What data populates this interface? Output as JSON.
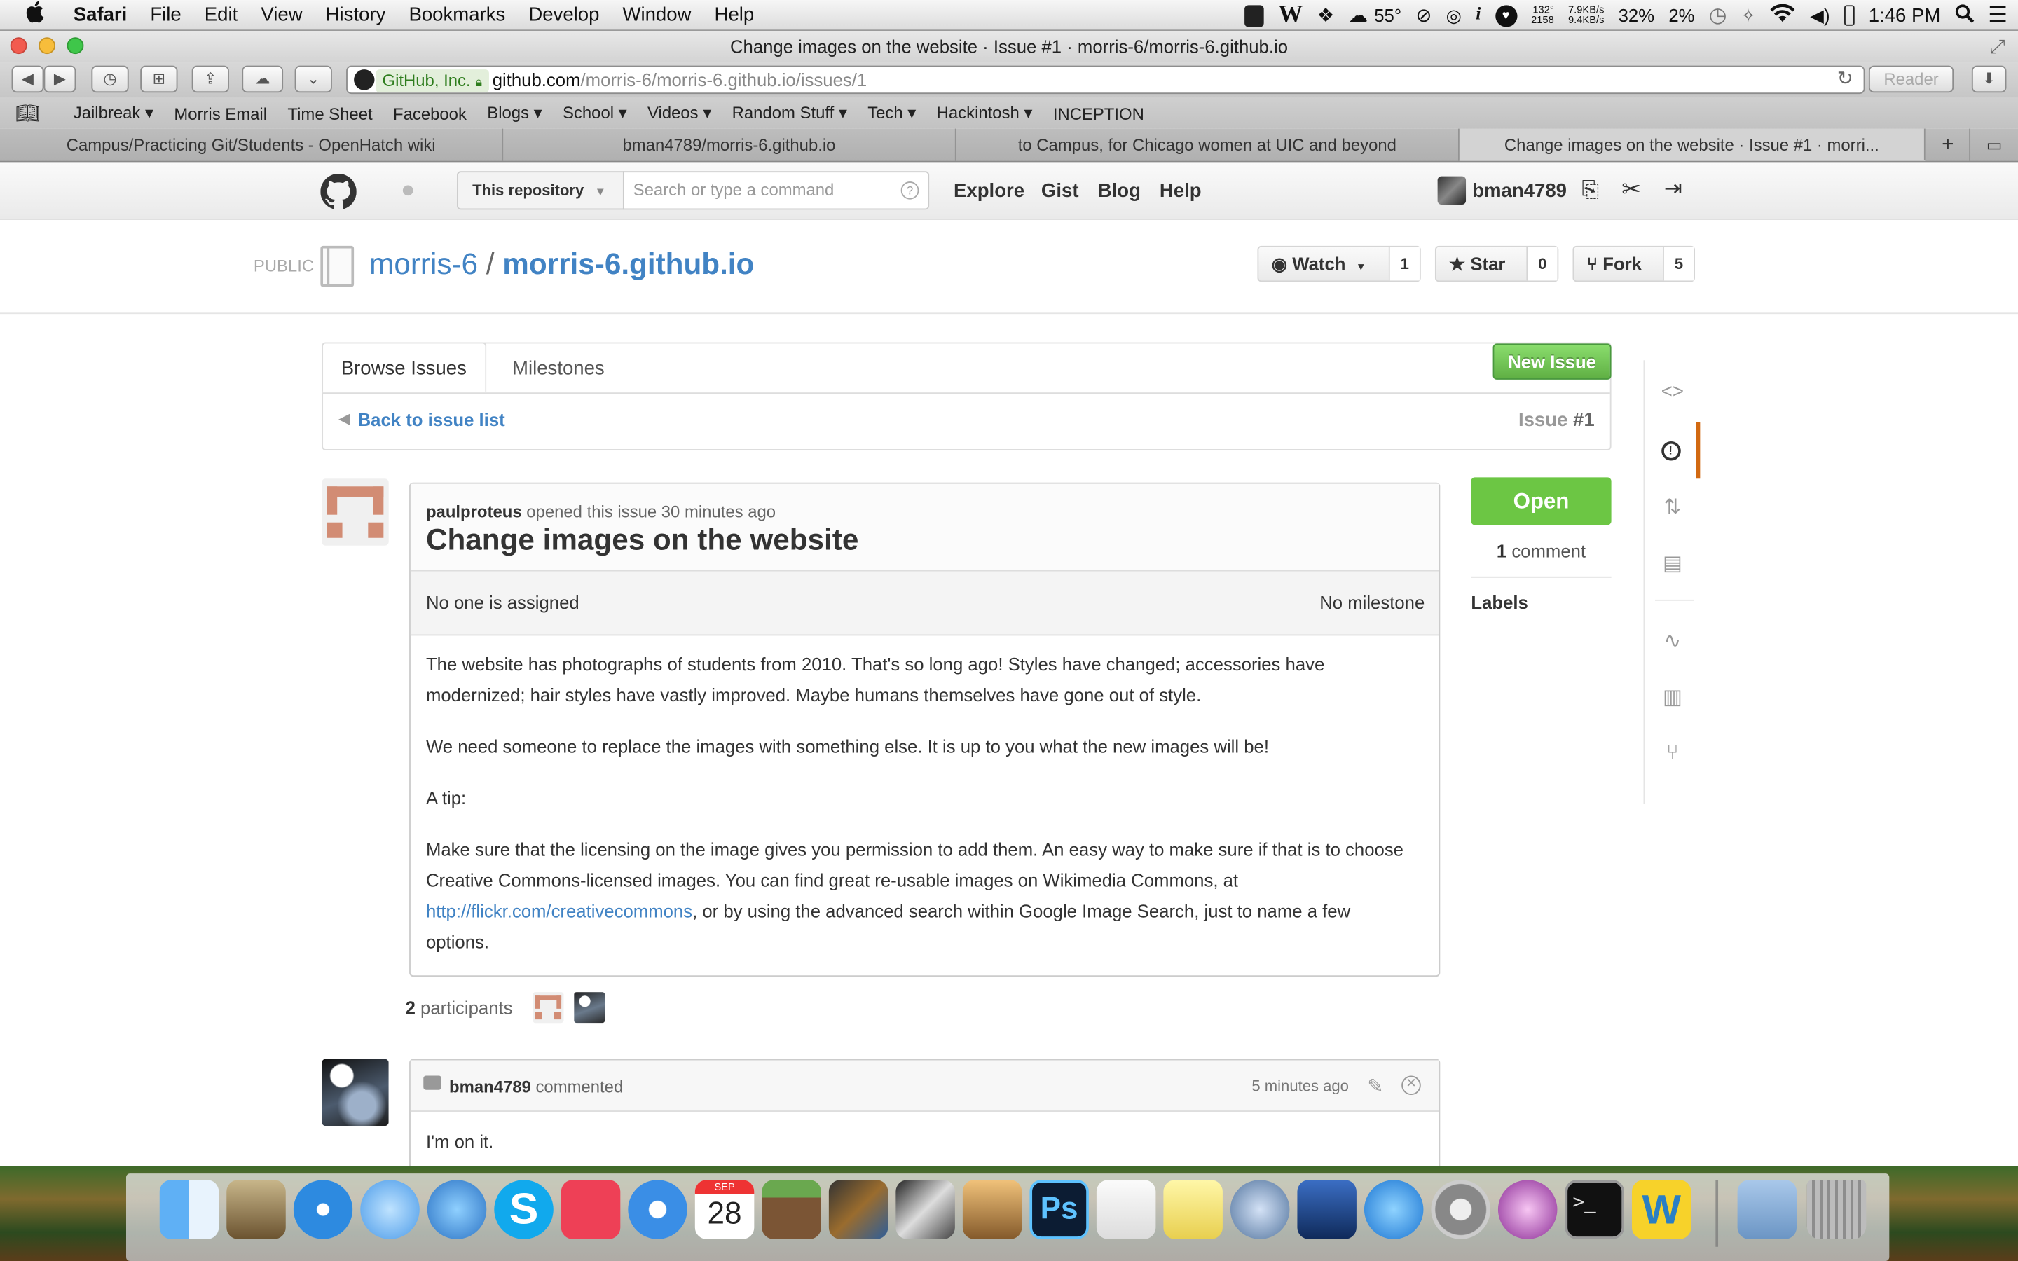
{
  "menubar": {
    "apple": "",
    "app": "Safari",
    "items": [
      "File",
      "Edit",
      "View",
      "History",
      "Bookmarks",
      "Develop",
      "Window",
      "Help"
    ],
    "temperature": "55°",
    "temp_sensor_top": "132°",
    "temp_sensor_bottom": "2158",
    "net_up": "7.9KB/s",
    "net_down": "9.4KB/s",
    "cpu": "32%",
    "mem": "2%",
    "time": "1:46 PM"
  },
  "window": {
    "title": "Change images on the website · Issue #1 · morris-6/morris-6.github.io"
  },
  "toolbar": {
    "ev_cert": "GitHub, Inc.",
    "url_host": "github.com",
    "url_path": "/morris-6/morris-6.github.io/issues/1",
    "reader": "Reader"
  },
  "bookmarks": [
    {
      "label": "Jailbreak ▾"
    },
    {
      "label": "Morris Email"
    },
    {
      "label": "Time Sheet"
    },
    {
      "label": "Facebook"
    },
    {
      "label": "Blogs ▾"
    },
    {
      "label": "School ▾"
    },
    {
      "label": "Videos ▾"
    },
    {
      "label": "Random Stuff ▾"
    },
    {
      "label": "Tech ▾"
    },
    {
      "label": "Hackintosh ▾"
    },
    {
      "label": "INCEPTION"
    }
  ],
  "tabs": [
    {
      "label": "Campus/Practicing Git/Students - OpenHatch wiki"
    },
    {
      "label": "bman4789/morris-6.github.io"
    },
    {
      "label": "to Campus, for Chicago women at UIC and beyond"
    },
    {
      "label": "Change images on the website · Issue #1 · morri..."
    }
  ],
  "gh": {
    "scope": "This repository",
    "search_placeholder": "Search or type a command",
    "nav": [
      "Explore",
      "Gist",
      "Blog",
      "Help"
    ],
    "user": "bman4789"
  },
  "repo": {
    "visibility": "PUBLIC",
    "owner": "morris-6",
    "sep": "/",
    "name": "morris-6.github.io",
    "watch_label": "Watch",
    "watch_count": "1",
    "star_label": "Star",
    "star_count": "0",
    "fork_label": "Fork",
    "fork_count": "5"
  },
  "issues_nav": {
    "tab_browse": "Browse Issues",
    "tab_milestones": "Milestones",
    "new_issue": "New Issue",
    "back": "Back to issue list",
    "issue_word": "Issue",
    "issue_num": "#1"
  },
  "issue": {
    "author": "paulproteus",
    "opened_text": "opened this issue 30 minutes ago",
    "title": "Change images on the website",
    "assignee": "No one is assigned",
    "milestone": "No milestone",
    "p1": "The website has photographs of students from 2010. That's so long ago! Styles have changed; accessories have modernized; hair styles have vastly improved. Maybe humans themselves have gone out of style.",
    "p2": "We need someone to replace the images with something else. It is up to you what the new images will be!",
    "p3": "A tip:",
    "p4a": "Make sure that the licensing on the image gives you permission to add them. An easy way to make sure if that is to choose Creative Commons-licensed images. You can find great re-usable images on Wikimedia Commons, at ",
    "p4link": "http://flickr.com/creativecommons",
    "p4b": ", or by using the advanced search within Google Image Search, just to name a few options.",
    "participants_count": "2",
    "participants_label": "participants"
  },
  "sidebar": {
    "state": "Open",
    "comment_count": "1",
    "comment_label": "comment",
    "labels_heading": "Labels"
  },
  "comment": {
    "author": "bman4789",
    "action": "commented",
    "time": "5 minutes ago",
    "body": "I'm on it."
  },
  "dock": {
    "calendar_month": "SEP",
    "calendar_day": "28"
  },
  "colors": {
    "link": "#4183c4",
    "open_green": "#6cc644",
    "new_issue_green": "#60b044",
    "sidenav_active": "#d26911"
  }
}
